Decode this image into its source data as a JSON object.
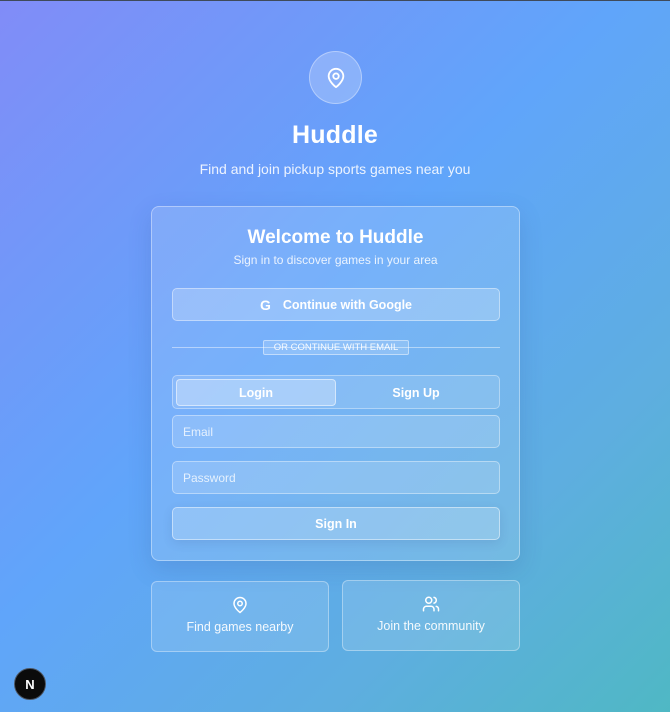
{
  "app": {
    "title": "Huddle",
    "subtitle": "Find and join pickup sports games near you",
    "logo_icon": "map-pin-icon"
  },
  "card": {
    "title": "Welcome to Huddle",
    "subtitle": "Sign in to discover games in your area",
    "google_button": "Continue with Google",
    "google_icon": "google-icon",
    "divider_text": "OR CONTINUE WITH EMAIL",
    "tabs": [
      {
        "label": "Login",
        "active": true
      },
      {
        "label": "Sign Up",
        "active": false
      }
    ],
    "email": {
      "placeholder": "Email",
      "value": ""
    },
    "password": {
      "placeholder": "Password",
      "value": ""
    },
    "submit_label": "Sign In"
  },
  "features": [
    {
      "label": "Find games nearby",
      "icon": "map-pin-icon"
    },
    {
      "label": "Join the community",
      "icon": "users-icon"
    }
  ],
  "badge": {
    "label": "N",
    "icon": "nextjs-icon"
  },
  "colors": {
    "gradient_start": "#818cf8",
    "gradient_mid": "#60a5fa",
    "gradient_end": "#4fb8c4",
    "text": "#ffffff"
  }
}
